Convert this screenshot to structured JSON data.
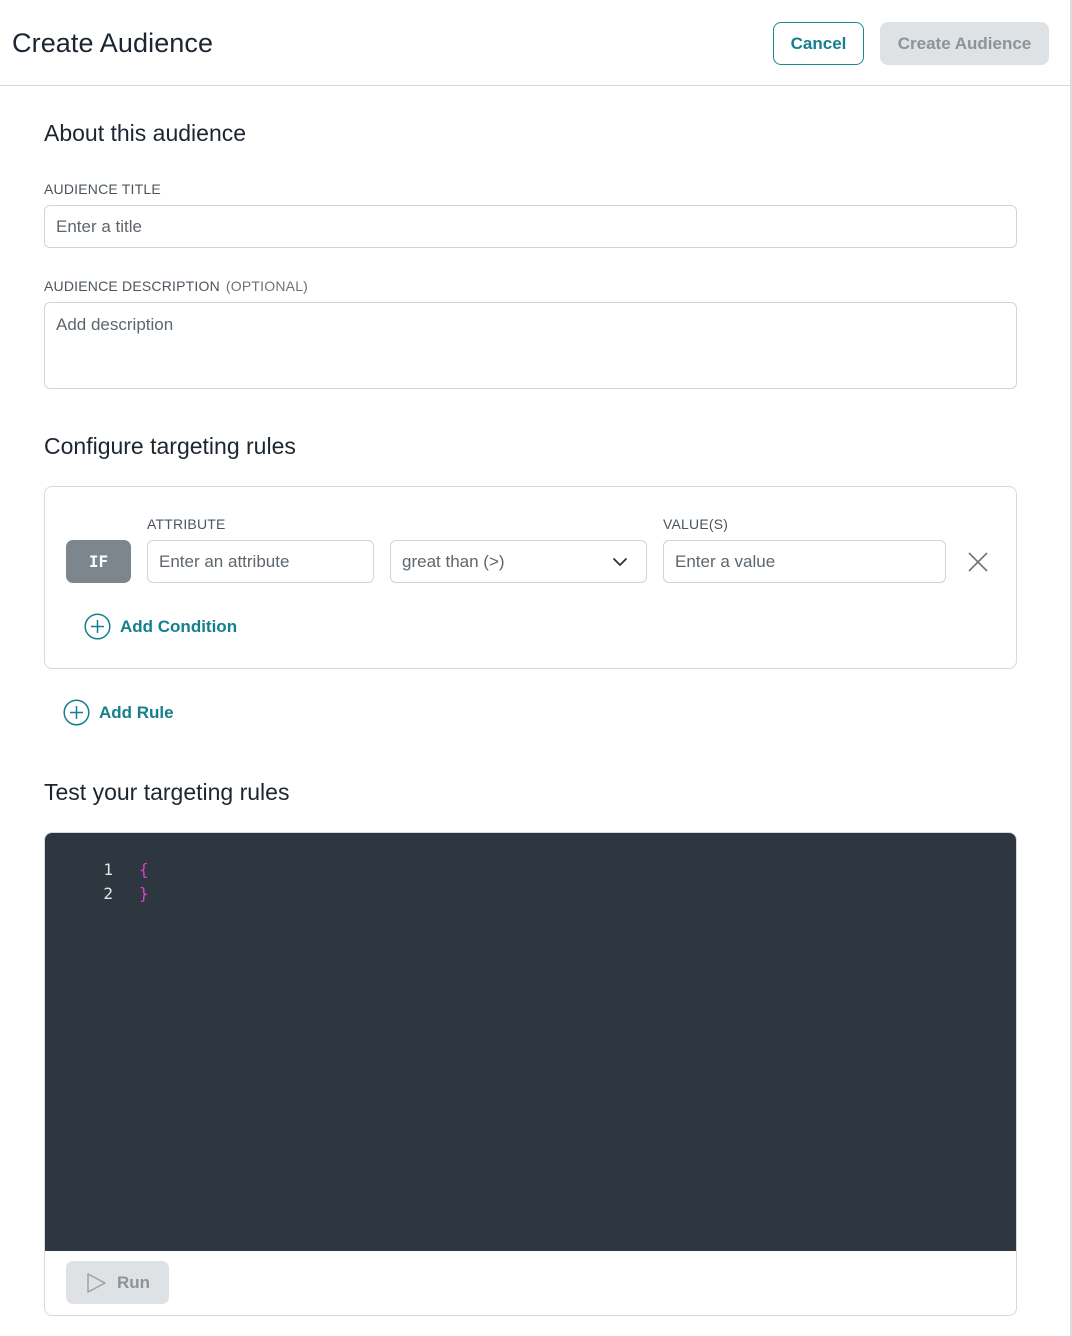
{
  "header": {
    "title": "Create Audience",
    "cancel_label": "Cancel",
    "create_label": "Create Audience"
  },
  "about": {
    "section_title": "About this audience",
    "title_label": "AUDIENCE TITLE",
    "title_placeholder": "Enter a title",
    "description_label": "AUDIENCE DESCRIPTION",
    "description_optional": "(OPTIONAL)",
    "description_placeholder": "Add description"
  },
  "rules": {
    "section_title": "Configure targeting rules",
    "condition_keyword": "IF",
    "attribute_label": "ATTRIBUTE",
    "attribute_placeholder": "Enter an attribute",
    "operator_selected": "great than (>)",
    "values_label": "VALUE(S)",
    "value_placeholder": "Enter a value",
    "add_condition_label": "Add Condition",
    "add_rule_label": "Add Rule"
  },
  "test": {
    "section_title": "Test your targeting rules",
    "code_lines": [
      {
        "number": "1",
        "text": "{"
      },
      {
        "number": "2",
        "text": "}"
      }
    ],
    "run_label": "Run"
  },
  "colors": {
    "accent": "#157f8e",
    "editor_bg": "#2e3740",
    "brace": "#e040c8",
    "disabled_bg": "#dfe2e5",
    "if_badge": "#7e868d"
  },
  "icons": {
    "operator_dropdown": "chevron-down-icon",
    "remove_condition": "close-icon",
    "add_condition": "plus-circle-icon",
    "add_rule": "plus-circle-icon",
    "run": "play-icon"
  }
}
